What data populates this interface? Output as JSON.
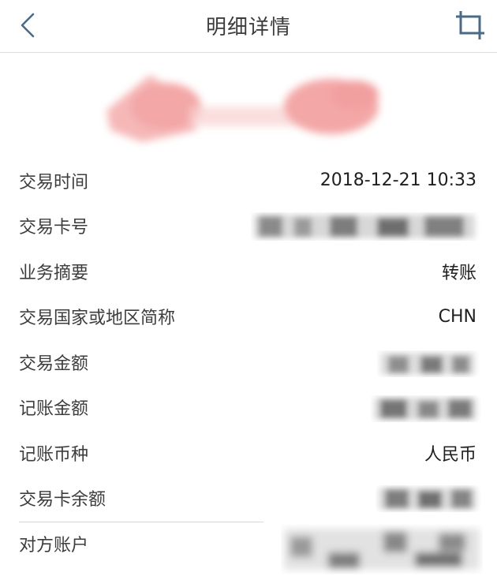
{
  "header": {
    "title": "明细详情"
  },
  "details": [
    {
      "label": "交易时间",
      "value": "2018-12-21 10:33"
    },
    {
      "label": "交易卡号",
      "value": ""
    },
    {
      "label": "业务摘要",
      "value": "转账"
    },
    {
      "label": "交易国家或地区简称",
      "value": "CHN"
    },
    {
      "label": "交易金额",
      "value": ""
    },
    {
      "label": "记账金额",
      "value": ""
    },
    {
      "label": "记账币种",
      "value": "人民币"
    },
    {
      "label": "交易卡余额",
      "value": ""
    },
    {
      "label": "对方账户",
      "value": ""
    }
  ],
  "colors": {
    "header_text": "#3c3c3c",
    "icon": "#4a6a86",
    "divider": "#dcdcdc",
    "redaction_pink": "#f08a8a",
    "redaction_gray": "#6b6b6b"
  },
  "icons": {
    "back": "chevron-left-icon",
    "crop": "crop-icon"
  }
}
